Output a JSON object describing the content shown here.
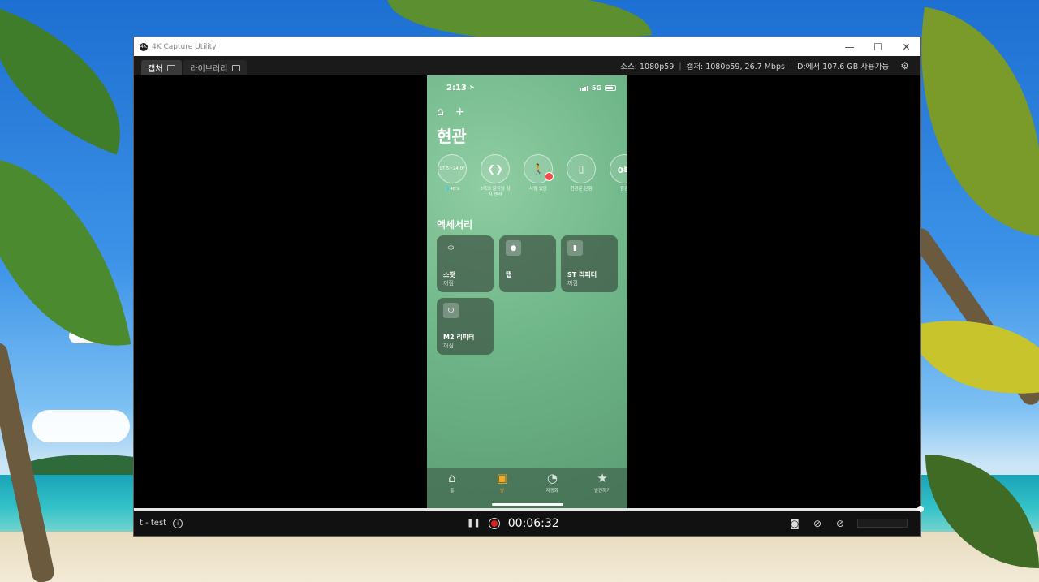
{
  "window": {
    "title": "4K Capture Utility",
    "app_icon": "4K",
    "controls": [
      "—",
      "☐",
      "✕"
    ]
  },
  "toolbar": {
    "tabs": [
      {
        "label": "캡처",
        "icon": "monitor-icon"
      },
      {
        "label": "라이브러리",
        "icon": "grid-icon"
      }
    ],
    "status": {
      "source": "소스: 1080p59",
      "capture": "캡처: 1080p59, 26.7 Mbps",
      "disk": "D:에서 107.6 GB 사용가능"
    }
  },
  "phone": {
    "time": "2:13",
    "network": "5G",
    "title": "현관",
    "circles": [
      {
        "text": "17.5~24.0°",
        "caption": "46%"
      },
      {
        "text": "",
        "caption": "2개의 움직임 감지 센서"
      },
      {
        "text": "",
        "caption": "사람 있음"
      },
      {
        "text": "",
        "caption": "현관문 닫힘"
      },
      {
        "text": "0록",
        "caption": "잠김"
      }
    ],
    "section_title": "액세서리",
    "tiles": [
      {
        "name": "스팟",
        "state": "꺼짐",
        "icon": "light-icon"
      },
      {
        "name": "탭",
        "state": "",
        "icon": "button-icon"
      },
      {
        "name": "ST 리피터",
        "state": "꺼짐",
        "icon": "repeater-icon"
      },
      {
        "name": "M2 리피터",
        "state": "꺼짐",
        "icon": "plug-icon"
      }
    ],
    "tabbar": [
      {
        "label": "홈",
        "icon": "⌂"
      },
      {
        "label": "방",
        "icon": "▣"
      },
      {
        "label": "자동화",
        "icon": "◔"
      },
      {
        "label": "발견하기",
        "icon": "★"
      }
    ]
  },
  "bottom": {
    "profile": "t - test",
    "timer": "00:06:32"
  }
}
